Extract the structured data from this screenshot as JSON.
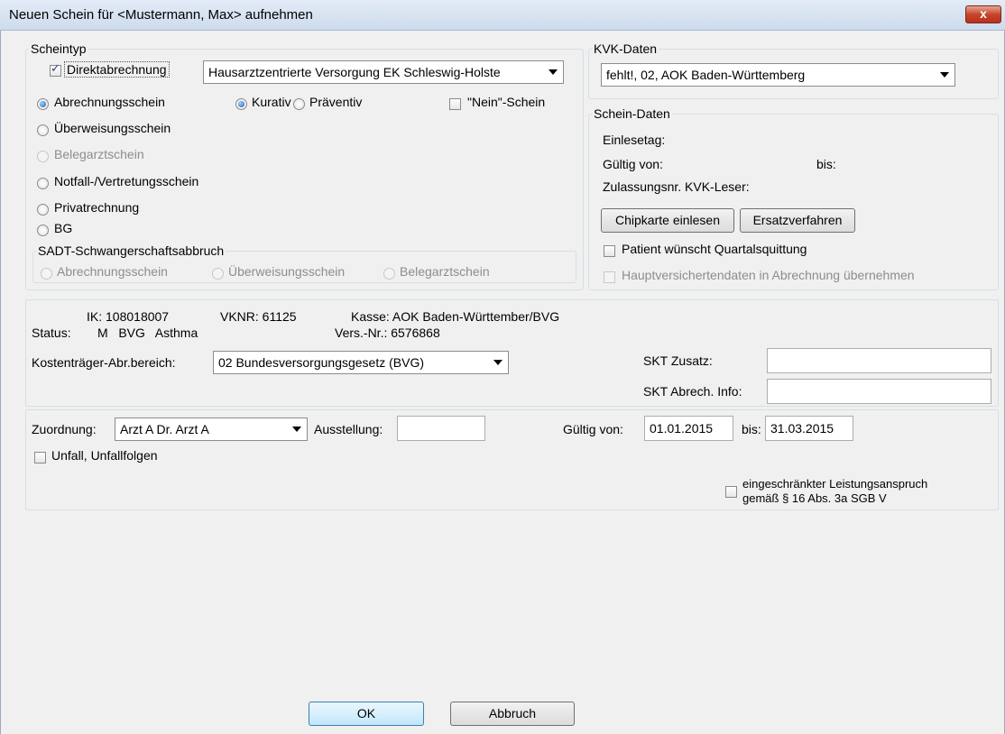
{
  "window": {
    "title": "Neuen Schein für <Mustermann, Max> aufnehmen",
    "close_label": "x"
  },
  "scheintyp": {
    "legend": "Scheintyp",
    "direktabrechnung_label": "Direktabrechnung",
    "direktabrechnung_checked": true,
    "vertrag_selected": "Hausarztzentrierte Versorgung EK Schleswig-Holste",
    "radios": [
      {
        "label": "Abrechnungsschein",
        "checked": true,
        "enabled": true
      },
      {
        "label": "Überweisungsschein",
        "checked": false,
        "enabled": true
      },
      {
        "label": "Belegarztschein",
        "checked": false,
        "enabled": false
      },
      {
        "label": "Notfall-/Vertretungsschein",
        "checked": false,
        "enabled": true
      },
      {
        "label": "Privatrechnung",
        "checked": false,
        "enabled": true
      },
      {
        "label": "BG",
        "checked": false,
        "enabled": true
      }
    ],
    "kurativ_label": "Kurativ",
    "praeventiv_label": "Präventiv",
    "nein_schein_label": "\"Nein\"-Schein",
    "sadt": {
      "legend": "SADT-Schwangerschaftsabbruch",
      "options": [
        "Abrechnungsschein",
        "Überweisungsschein",
        "Belegarztschein"
      ]
    }
  },
  "kvk": {
    "legend": "KVK-Daten",
    "selected": "fehlt!, 02, AOK Baden-Württemberg"
  },
  "schein_daten": {
    "legend": "Schein-Daten",
    "einlesetag_label": "Einlesetag:",
    "gueltig_von_label": "Gültig von:",
    "bis_label": "bis:",
    "zulassungsnr_label": "Zulassungsnr. KVK-Leser:",
    "chipkarte_button": "Chipkarte einlesen",
    "ersatzverfahren_button": "Ersatzverfahren",
    "quartalsquittung_label": "Patient wünscht Quartalsquittung",
    "hauptversicherten_label": "Hauptversichertendaten in Abrechnung übernehmen"
  },
  "kasse": {
    "ik": "IK: 108018007",
    "vknr": "VKNR: 61125",
    "kasse": "Kasse: AOK Baden-Württember/BVG",
    "status_label": "Status:",
    "status_values": "M   BVG   Asthma",
    "vers_nr": "Vers.-Nr.: 6576868",
    "kostentraeger_label": "Kostenträger-Abr.bereich:",
    "kostentraeger_selected": "02  Bundesversorgungsgesetz (BVG)",
    "skt_zusatz_label": "SKT Zusatz:",
    "skt_zusatz_value": "",
    "skt_abrech_label": "SKT Abrech. Info:",
    "skt_abrech_value": ""
  },
  "zuordnung": {
    "label": "Zuordnung:",
    "selected": "Arzt A Dr. Arzt A",
    "ausstellung_label": "Ausstellung:",
    "ausstellung_value": "",
    "gueltig_von_label": "Gültig von:",
    "gueltig_von_value": "01.01.2015",
    "bis_label": "bis:",
    "bis_value": "31.03.2015",
    "unfall_label": "Unfall, Unfallfolgen",
    "leistungsanspruch_line1": "eingeschränkter Leistungsanspruch",
    "leistungsanspruch_line2": "gemäß § 16 Abs. 3a SGB V"
  },
  "buttons": {
    "ok": "OK",
    "abbruch": "Abbruch"
  }
}
